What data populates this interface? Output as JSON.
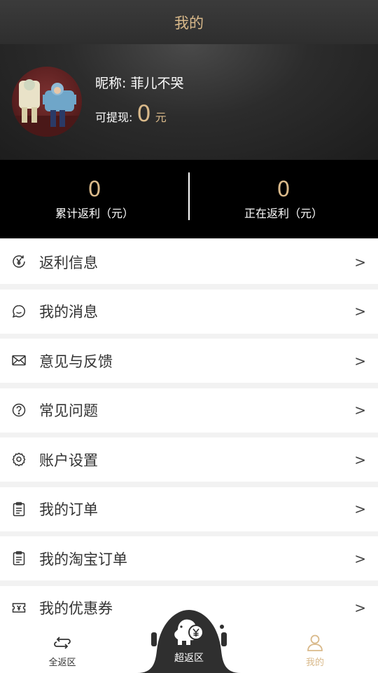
{
  "header": {
    "title": "我的"
  },
  "profile": {
    "nickname_label": "昵称:",
    "nickname": "菲儿不哭",
    "withdraw_label": "可提现:",
    "withdraw_amount": "0",
    "withdraw_unit": "元"
  },
  "stats": {
    "cumulative": {
      "value": "0",
      "label": "累计返利（元）"
    },
    "pending": {
      "value": "0",
      "label": "正在返利（元）"
    }
  },
  "menu": {
    "items": [
      {
        "label": "返利信息",
        "icon": "rebate-yen-icon",
        "chevron": ">"
      },
      {
        "label": "我的消息",
        "icon": "chat-bubble-icon",
        "chevron": ">"
      },
      {
        "label": "意见与反馈",
        "icon": "envelope-icon",
        "chevron": ">"
      },
      {
        "label": "常见问题",
        "icon": "question-circle-icon",
        "chevron": ">"
      },
      {
        "label": "账户设置",
        "icon": "gear-icon",
        "chevron": ">"
      },
      {
        "label": "我的订单",
        "icon": "clipboard-icon",
        "chevron": ">"
      },
      {
        "label": "我的淘宝订单",
        "icon": "clipboard-icon",
        "chevron": ">"
      },
      {
        "label": "我的优惠券",
        "icon": "coupon-ticket-icon",
        "chevron": ">"
      }
    ]
  },
  "tabbar": {
    "all_rebate": "全返区",
    "super_rebate": "超返区",
    "mine": "我的",
    "active": "mine"
  },
  "colors": {
    "accent_gold": "#d9b98a",
    "header_bg": "#333333",
    "stats_bg": "#000000"
  }
}
